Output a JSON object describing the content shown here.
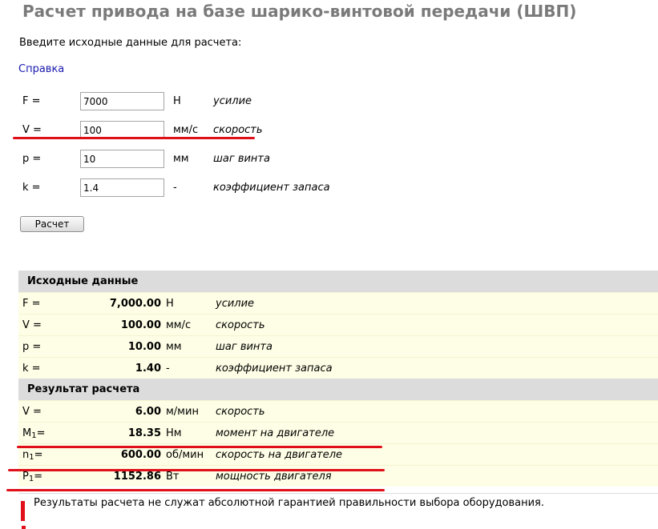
{
  "page": {
    "title": "Расчет привода на базе шарико-винтовой передачи (ШВП)",
    "prompt": "Введите исходные данные для расчета:",
    "help_link": "Справка",
    "calc_button": "Расчет"
  },
  "inputs": [
    {
      "label": "F =",
      "value": "7000",
      "unit": "Н",
      "desc": "усилие"
    },
    {
      "label": "V =",
      "value": "100",
      "unit": "мм/с",
      "desc": "скорость"
    },
    {
      "label": "p =",
      "value": "10",
      "unit": "мм",
      "desc": "шаг винта"
    },
    {
      "label": "k =",
      "value": "1.4",
      "unit": "-",
      "desc": "коэффициент запаса"
    }
  ],
  "source_section": {
    "header": "Исходные данные",
    "rows": [
      {
        "label": "F =",
        "value": "7,000.00",
        "unit": "Н",
        "desc": "усилие"
      },
      {
        "label": "V =",
        "value": "100.00",
        "unit": "мм/с",
        "desc": "скорость"
      },
      {
        "label": "p =",
        "value": "10.00",
        "unit": "мм",
        "desc": "шаг винта"
      },
      {
        "label": "k =",
        "value": "1.40",
        "unit": "-",
        "desc": "коэффициент запаса"
      }
    ]
  },
  "result_section": {
    "header": "Результат расчета",
    "rows": [
      {
        "label": "V =",
        "value": "6.00",
        "unit": "м/мин",
        "desc": "скорость"
      },
      {
        "label_main": "M",
        "label_sub": "1",
        "label_tail": "=",
        "value": "18.35",
        "unit": "Нм",
        "desc": "момент на двигателе"
      },
      {
        "label_main": "n",
        "label_sub": "1",
        "label_tail": "=",
        "value": "600.00",
        "unit": "об/мин",
        "desc": "скорость на двигателе"
      },
      {
        "label_main": "P",
        "label_sub": "1",
        "label_tail": "=",
        "value": "1152.86",
        "unit": "Вт",
        "desc": "мощность двигателя"
      }
    ]
  },
  "disclaimer": "Результаты расчета не служат абсолютной гарантией правильности выбора оборудования.",
  "colors": {
    "annotation_red": "#e0101a",
    "header_gray": "#dcdcdc",
    "row_yellow": "#fefee6",
    "link_blue": "#1a1ab0"
  }
}
